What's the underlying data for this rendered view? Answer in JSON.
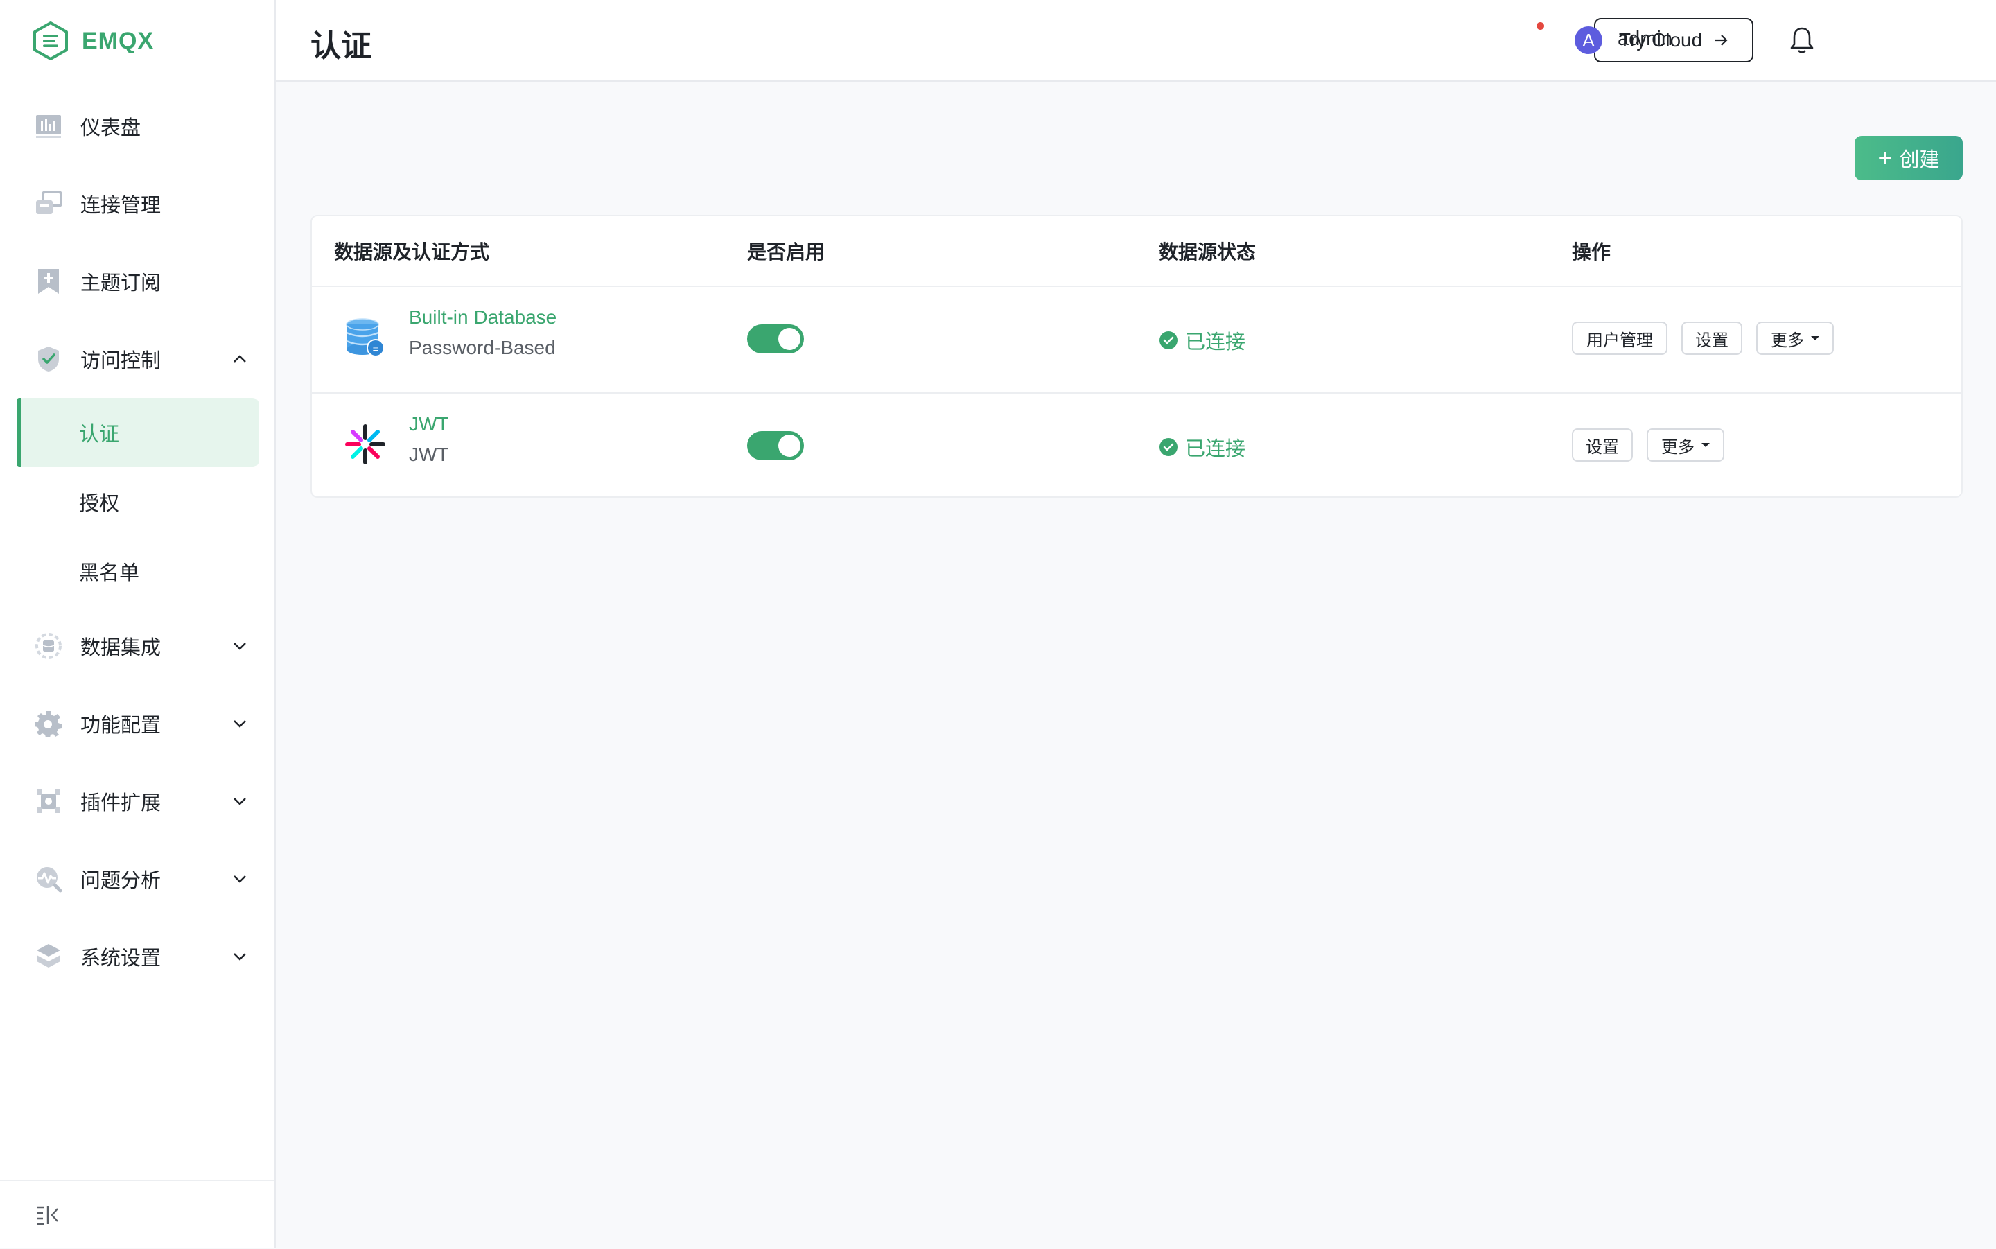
{
  "brand": {
    "name": "EMQX"
  },
  "sidebar": {
    "items": [
      {
        "label": "仪表盘",
        "icon": "dashboard-icon"
      },
      {
        "label": "连接管理",
        "icon": "connections-icon"
      },
      {
        "label": "主题订阅",
        "icon": "topic-subscription-icon"
      },
      {
        "label": "访问控制",
        "icon": "shield-check-icon",
        "expanded": true,
        "children": [
          {
            "label": "认证",
            "active": true
          },
          {
            "label": "授权"
          },
          {
            "label": "黑名单"
          }
        ]
      },
      {
        "label": "数据集成",
        "icon": "data-integration-icon"
      },
      {
        "label": "功能配置",
        "icon": "gear-icon"
      },
      {
        "label": "插件扩展",
        "icon": "puzzle-icon"
      },
      {
        "label": "问题分析",
        "icon": "diagnose-icon"
      },
      {
        "label": "系统设置",
        "icon": "layers-icon"
      }
    ],
    "collapse_icon": "collapse-sidebar-icon"
  },
  "header": {
    "title": "认证",
    "try_cloud": "Try Cloud",
    "user": {
      "avatar_letter": "A",
      "name": "admin"
    },
    "has_notification": true
  },
  "toolbar": {
    "create_label": "创建"
  },
  "table": {
    "columns": [
      "数据源及认证方式",
      "是否启用",
      "数据源状态",
      "操作"
    ],
    "rows": [
      {
        "name": "Built-in Database",
        "type": "Password-Based",
        "icon": "database-icon",
        "enabled": true,
        "status": "已连接",
        "actions": [
          "用户管理",
          "设置",
          "更多"
        ]
      },
      {
        "name": "JWT",
        "type": "JWT",
        "icon": "jwt-icon",
        "enabled": true,
        "status": "已连接",
        "actions": [
          "设置",
          "更多"
        ]
      }
    ]
  },
  "colors": {
    "accent": "#3aa66f",
    "active_bg": "#e6f5ed",
    "avatar": "#5d5cde",
    "notification_dot": "#e4483f"
  }
}
